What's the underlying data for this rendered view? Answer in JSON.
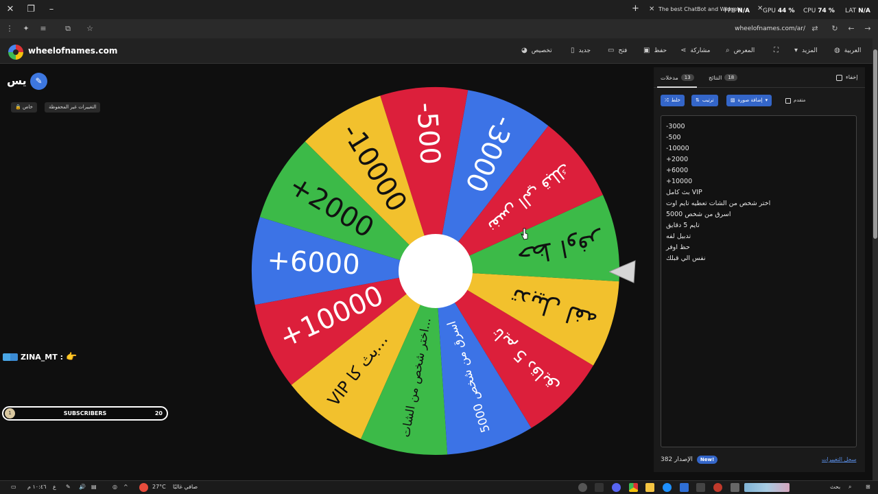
{
  "browser": {
    "tab_title": "The best ChatBot and Widgets",
    "url": "wheelofnames.com/ar/",
    "overlay_stats": [
      {
        "label": "FPS",
        "value": "N/A"
      },
      {
        "label": "GPU",
        "value": "44 %"
      },
      {
        "label": "CPU",
        "value": "74 %"
      },
      {
        "label": "LAT",
        "value": "N/A"
      }
    ]
  },
  "nav": {
    "site_name": "wheelofnames.com",
    "items": [
      {
        "label": "تخصيص",
        "icon": "palette-icon"
      },
      {
        "label": "جديد",
        "icon": "file-icon"
      },
      {
        "label": "فتح",
        "icon": "folder-icon"
      },
      {
        "label": "حفظ",
        "icon": "save-icon"
      },
      {
        "label": "مشاركة",
        "icon": "share-icon"
      },
      {
        "label": "المعرض",
        "icon": "search-icon"
      },
      {
        "label": "",
        "icon": "fullscreen-icon"
      },
      {
        "label": "المزيد",
        "icon": "chevron-down-icon"
      },
      {
        "label": "العربية",
        "icon": "globe-icon"
      }
    ]
  },
  "left": {
    "wheel_title": "يس",
    "chip_private": "خاص",
    "chip_unsaved": "التغييرات غير المحفوظة",
    "chat_user": "ZINA_MT :",
    "subs_current": "1",
    "subs_label": "SUBSCRIBERS",
    "subs_goal": "20"
  },
  "wheel": {
    "segments": [
      {
        "label": "-3000",
        "color": "#3c73e6"
      },
      {
        "label": "-500",
        "color": "#dc1f3b"
      },
      {
        "label": "-10000",
        "color": "#f2c12d"
      },
      {
        "label": "+2000",
        "color": "#3cba48"
      },
      {
        "label": "+6000",
        "color": "#3c73e6"
      },
      {
        "label": "+10000",
        "color": "#dc1f3b"
      },
      {
        "label": "VIP بث كامل",
        "color": "#f2c12d"
      },
      {
        "label": "اختر شخص من الشات تعطيه تايم اوت",
        "color": "#3cba48"
      },
      {
        "label": "اسرق من شخص 5000",
        "color": "#3c73e6"
      },
      {
        "label": "تايم 5 دقايق",
        "color": "#dc1f3b"
      },
      {
        "label": "تدبيل لفه",
        "color": "#f2c12d"
      },
      {
        "label": "حظ اوفر",
        "color": "#3cba48"
      },
      {
        "label": "نفس الي قبلك",
        "color": "#dc1f3b"
      }
    ],
    "display_labels": [
      "-3000",
      "-500",
      "-10000",
      "+2000",
      "+6000",
      "+10000",
      "VIP بث كا...",
      "اختر شخص من الشات...",
      "اسرق من شخص 5000",
      "تايم 5 دقايق",
      "تدبيل لفه",
      "حظ اوفر",
      "نفس الي قبلك"
    ]
  },
  "panel": {
    "tab_entries": "مدخلات",
    "entries_count": "13",
    "tab_results": "النتائج",
    "results_count": "18",
    "hide_label": "إخفاء",
    "btn_shuffle": "خلط",
    "btn_sort": "ترتيب",
    "btn_add_image": "إضافة صورة",
    "advanced_label": "متقدم",
    "entries": [
      "-3000",
      "-500",
      "-10000",
      "+2000",
      "+6000",
      "+10000",
      "بث كامل VIP",
      "اختر شخص من الشات تعطيه تايم اوت",
      "اسرق من شخص 5000",
      "تايم 5 دقايق",
      "تدبيل لفه",
      "حظ اوفر",
      "نفس الي قبلك"
    ],
    "version_label": "الإصدار 382",
    "new_badge": "New!",
    "changelog": "سجل التغييرات"
  },
  "taskbar": {
    "weather": "27°C",
    "weather_text": "صافي غالبًا",
    "search": "بحث",
    "time": "١٠:٤٦ م",
    "lang": "ع"
  }
}
